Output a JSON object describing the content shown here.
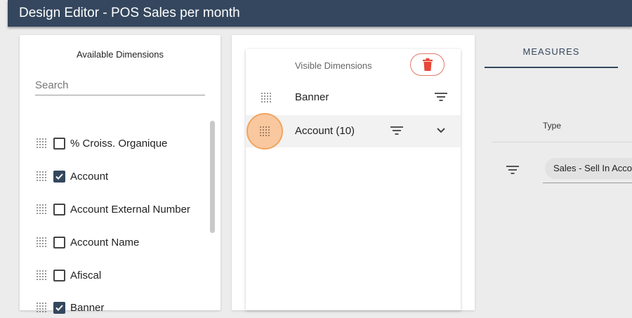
{
  "window": {
    "title": "Design Editor - POS Sales per month"
  },
  "available": {
    "title": "Available Dimensions",
    "search_placeholder": "Search",
    "items": [
      {
        "label": "% Croiss. Organique",
        "checked": false
      },
      {
        "label": "Account",
        "checked": true
      },
      {
        "label": "Account External Number",
        "checked": false
      },
      {
        "label": "Account Name",
        "checked": false
      },
      {
        "label": "Afiscal",
        "checked": false
      },
      {
        "label": "Banner",
        "checked": true
      }
    ]
  },
  "visible": {
    "title": "Visible Dimensions",
    "delete_icon": "trash-icon",
    "rows": [
      {
        "label": "Banner"
      },
      {
        "label": "Account (10)"
      }
    ]
  },
  "measures": {
    "tab_label": "MEASURES",
    "type_header": "Type",
    "chip_label": "Sales - Sell In Account"
  },
  "colors": {
    "header": "#34475e",
    "accent": "#34475e",
    "delete": "#e8473a",
    "highlight": "#f9c89f"
  }
}
